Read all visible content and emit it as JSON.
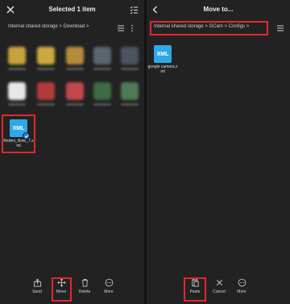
{
  "left": {
    "title": "Selected 1 item",
    "path": "Internal shared storage > Download >",
    "file": {
      "icon_text": "XML",
      "name": "Redmi_Note_7.xml",
      "selected": true
    },
    "actions": [
      {
        "label": "Send",
        "icon": "send-icon"
      },
      {
        "label": "Move",
        "icon": "move-icon"
      },
      {
        "label": "Delete",
        "icon": "delete-icon"
      },
      {
        "label": "More",
        "icon": "more-icon"
      }
    ],
    "blurred_thumb_colors": [
      "#c9a13b",
      "#cda83e",
      "#b58a3a",
      "#5a6672",
      "#4b5560",
      "#e8e8e8",
      "#b23a3d",
      "#c2474a",
      "#3d6b45",
      "#4e7a57"
    ]
  },
  "right": {
    "title": "Move to...",
    "path": "Internal shared storage > GCam > Configs >",
    "file": {
      "icon_text": "XML",
      "name": "google camera.xml"
    },
    "actions": [
      {
        "label": "Paste",
        "icon": "paste-icon"
      },
      {
        "label": "Cancel",
        "icon": "cancel-icon"
      },
      {
        "label": "More",
        "icon": "more-icon"
      }
    ]
  },
  "colors": {
    "highlight": "#e3262e",
    "xml_blue": "#2ea8e6",
    "check_blue": "#2f7be0"
  }
}
